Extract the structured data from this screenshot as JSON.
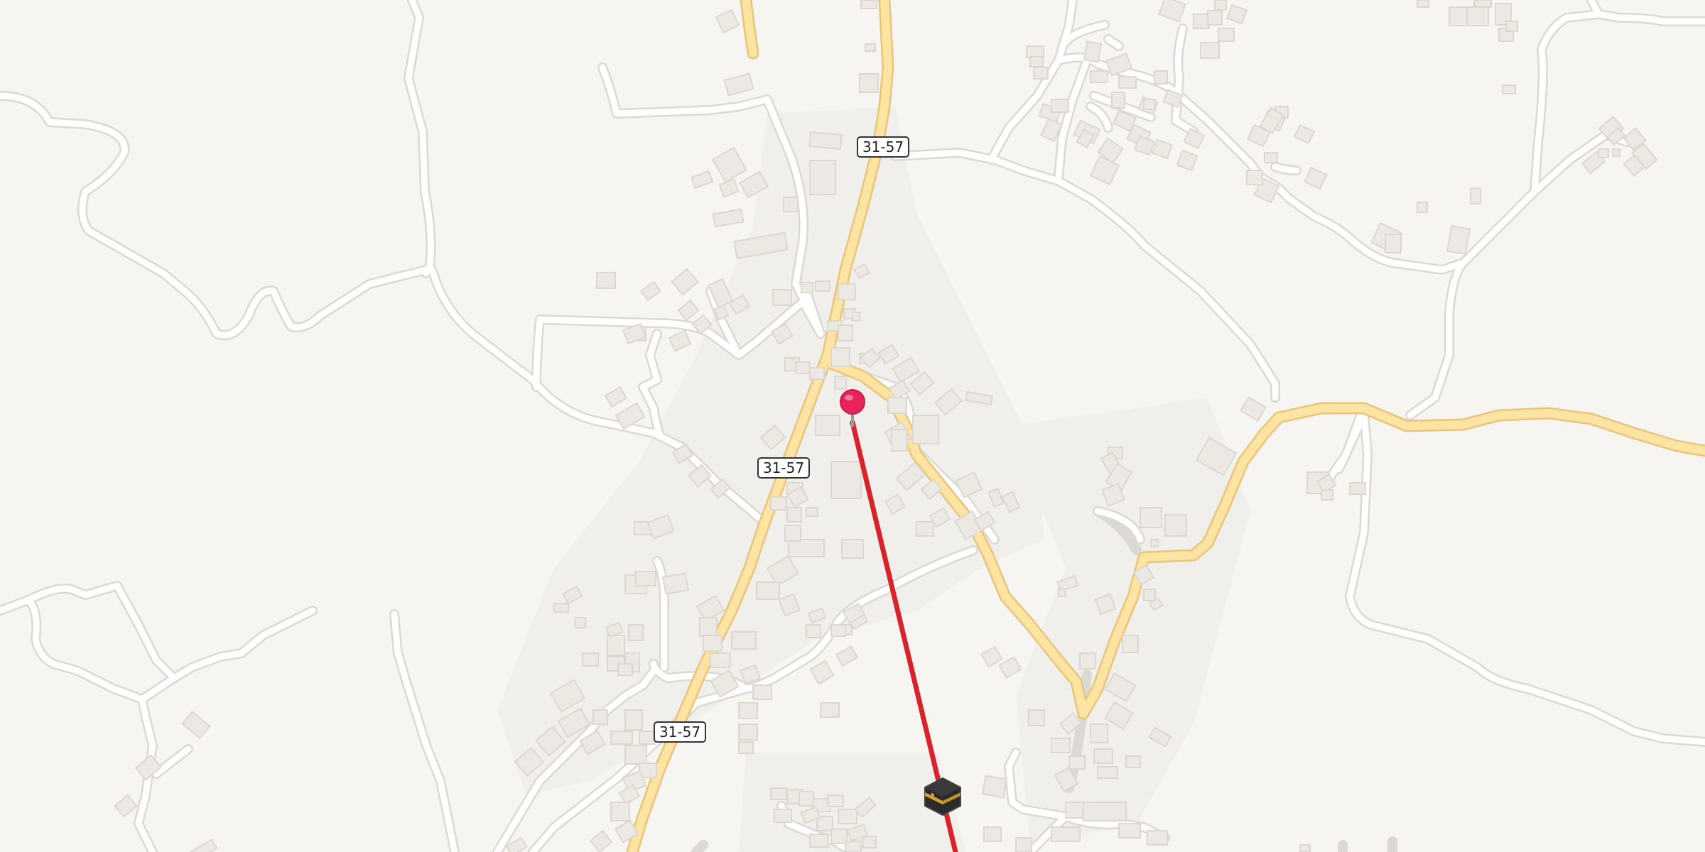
{
  "map": {
    "colors": {
      "land": "#f7f5f2",
      "settlement": "#f1efec",
      "building": "#ece8e3",
      "building_edge": "#ddd7d0",
      "minor_road": "#ffffff",
      "minor_road_casing": "#dcd8d3",
      "main_road": "#fde4a2",
      "main_road_casing": "#e7c57b",
      "route_line": "#d8232a",
      "pin": "#e8245a"
    },
    "road_shields": [
      {
        "label": "31-57"
      },
      {
        "label": "31-57"
      },
      {
        "label": "31-57"
      }
    ],
    "markers": {
      "location_pin": "map-pin-icon",
      "destination": "kaaba-icon"
    }
  }
}
